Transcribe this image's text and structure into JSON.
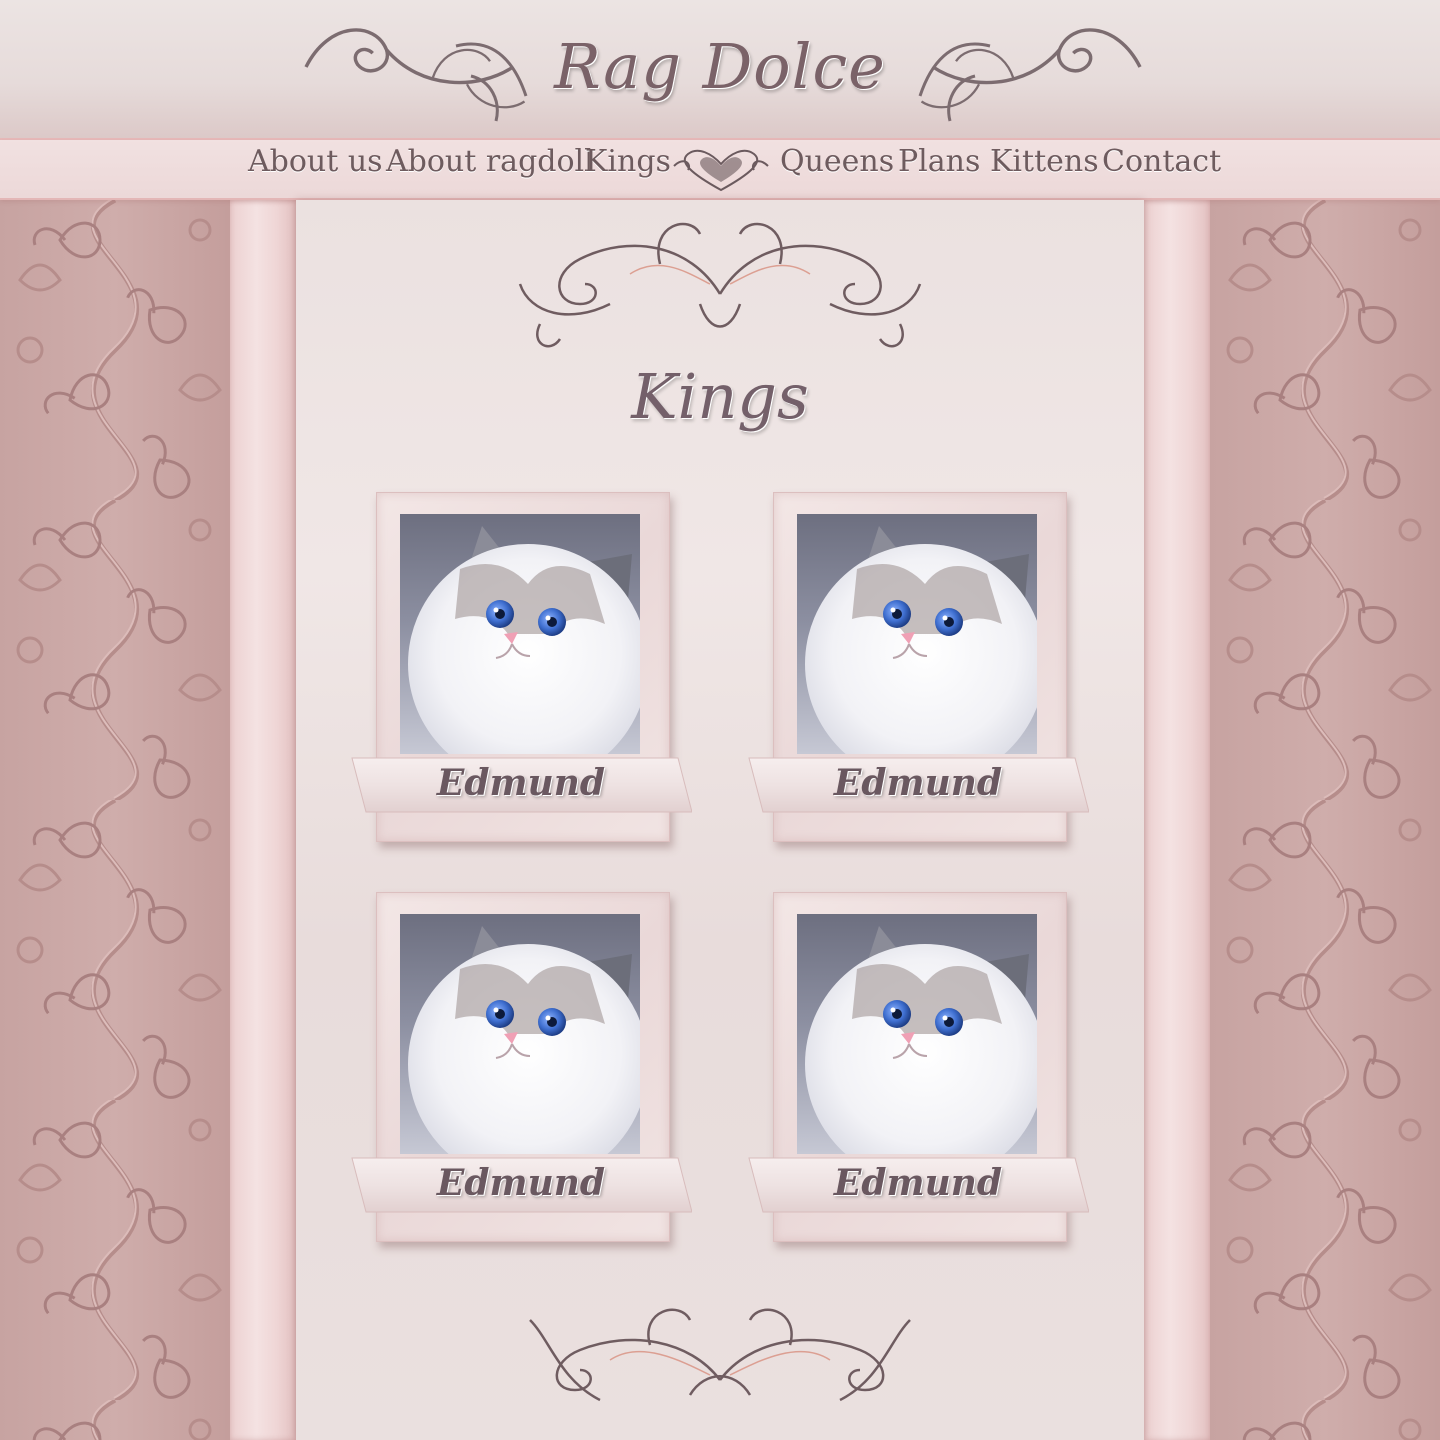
{
  "site": {
    "logo_text": "Rag Dolce"
  },
  "nav": {
    "items": [
      {
        "label": "About us"
      },
      {
        "label": "About ragdoll"
      },
      {
        "label": "Kings"
      },
      {
        "label": "Queens"
      },
      {
        "label": "Plans"
      },
      {
        "label": "Kittens"
      },
      {
        "label": "Contact"
      }
    ]
  },
  "page": {
    "title": "Kings",
    "cards": [
      {
        "name": "Edmund"
      },
      {
        "name": "Edmund"
      },
      {
        "name": "Edmund"
      },
      {
        "name": "Edmund"
      }
    ]
  },
  "colors": {
    "background": "#c9a8a6",
    "accent_pink": "#e7b9b9",
    "text": "#6e5b5e",
    "cat_eyes": "#3f6fd0"
  },
  "icons": [
    "flourish-left-icon",
    "flourish-right-icon",
    "heart-ornament-icon",
    "scroll-ornament-icon",
    "floral-pattern"
  ]
}
